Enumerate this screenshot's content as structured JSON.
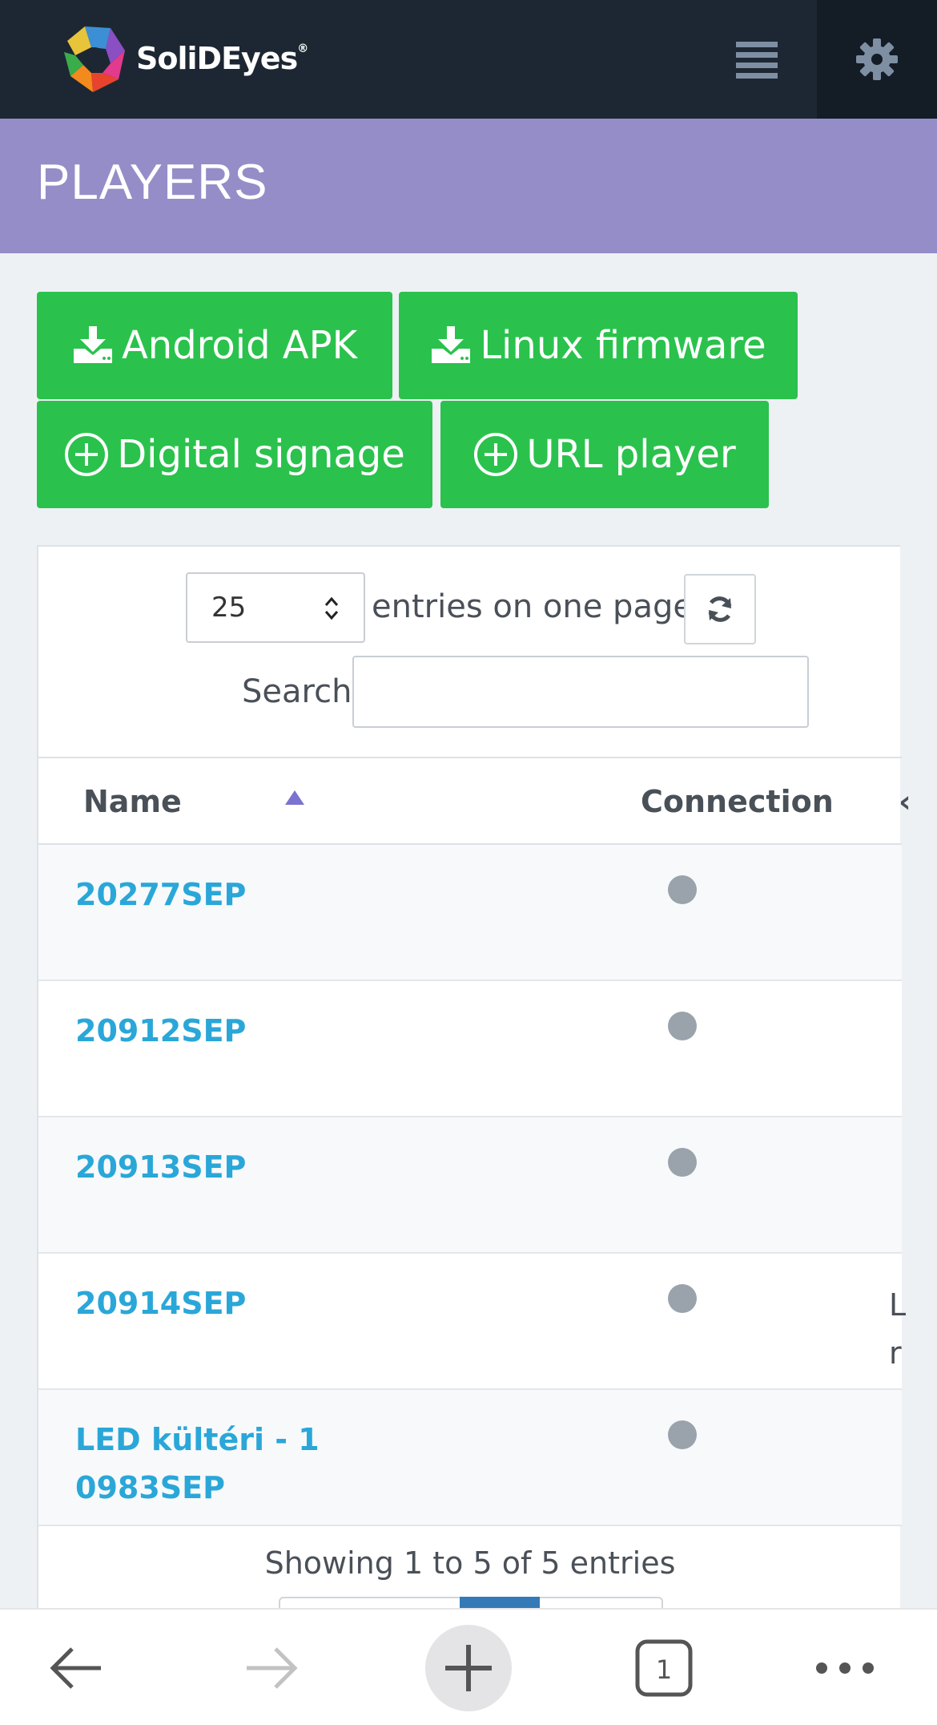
{
  "navbar": {
    "logo_text": "SoliDEyes",
    "logo_mark": "®"
  },
  "page": {
    "title": "PLAYERS"
  },
  "actions": {
    "android_apk": "Android APK",
    "linux_firmware": "Linux firmware",
    "digital_signage": "Digital signage",
    "url_player": "URL player"
  },
  "table_controls": {
    "page_size": "25",
    "entries_label": "entries on one page",
    "search_label": "Search",
    "search_value": ""
  },
  "table": {
    "columns": {
      "name": "Name",
      "connection": "Connection"
    },
    "rows": [
      {
        "name": "20277SEP",
        "connection": "offline"
      },
      {
        "name": "20912SEP",
        "connection": "offline"
      },
      {
        "name": "20913SEP",
        "connection": "offline"
      },
      {
        "name": "20914SEP",
        "connection": "offline"
      },
      {
        "name": "LED kültéri - 1 0983SEP",
        "connection": "offline"
      }
    ]
  },
  "footer": {
    "showing": "Showing 1 to 5 of 5 entries"
  },
  "browser": {
    "tab_count": "1"
  },
  "colors": {
    "navbar": "#1d2733",
    "header": "#958dc8",
    "button_green": "#2ac24c",
    "link_blue": "#2aa7d8",
    "status_offline": "#9aa3ab"
  }
}
